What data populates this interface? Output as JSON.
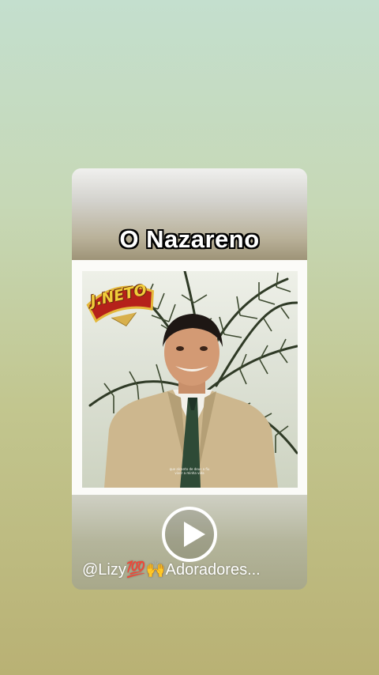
{
  "video": {
    "title": "O Nazareno",
    "handle": "@Lizy💯🙌Adoradores..."
  },
  "album": {
    "logo_text": "J.NETO",
    "cover_caption": "que alcanto de deus a fiu viver a minha vida"
  },
  "controls": {
    "play_icon": "play-icon"
  },
  "colors": {
    "title_fill": "#ffffff",
    "title_outline": "#000000",
    "logo_yellow": "#f1cd3a",
    "logo_red": "#b5211a"
  }
}
